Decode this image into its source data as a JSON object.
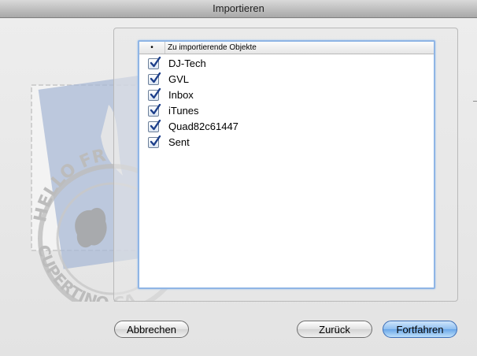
{
  "window": {
    "title": "Importieren"
  },
  "list": {
    "check_column_header": "•",
    "name_column_header": "Zu importierende Objekte",
    "items": [
      {
        "label": "DJ-Tech",
        "checked": true
      },
      {
        "label": "GVL",
        "checked": true
      },
      {
        "label": "Inbox",
        "checked": true
      },
      {
        "label": "iTunes",
        "checked": true
      },
      {
        "label": "Quad82c61447",
        "checked": true
      },
      {
        "label": "Sent",
        "checked": true
      }
    ]
  },
  "stamp": {
    "text_top": "HELLO FR",
    "text_bottom": "CUPERTINO CA"
  },
  "buttons": {
    "cancel": "Abbrechen",
    "back": "Zurück",
    "continue": "Fortfahren"
  },
  "colors": {
    "accent": "#8fb5e5",
    "checkbox_tick": "#1d3f8a"
  }
}
